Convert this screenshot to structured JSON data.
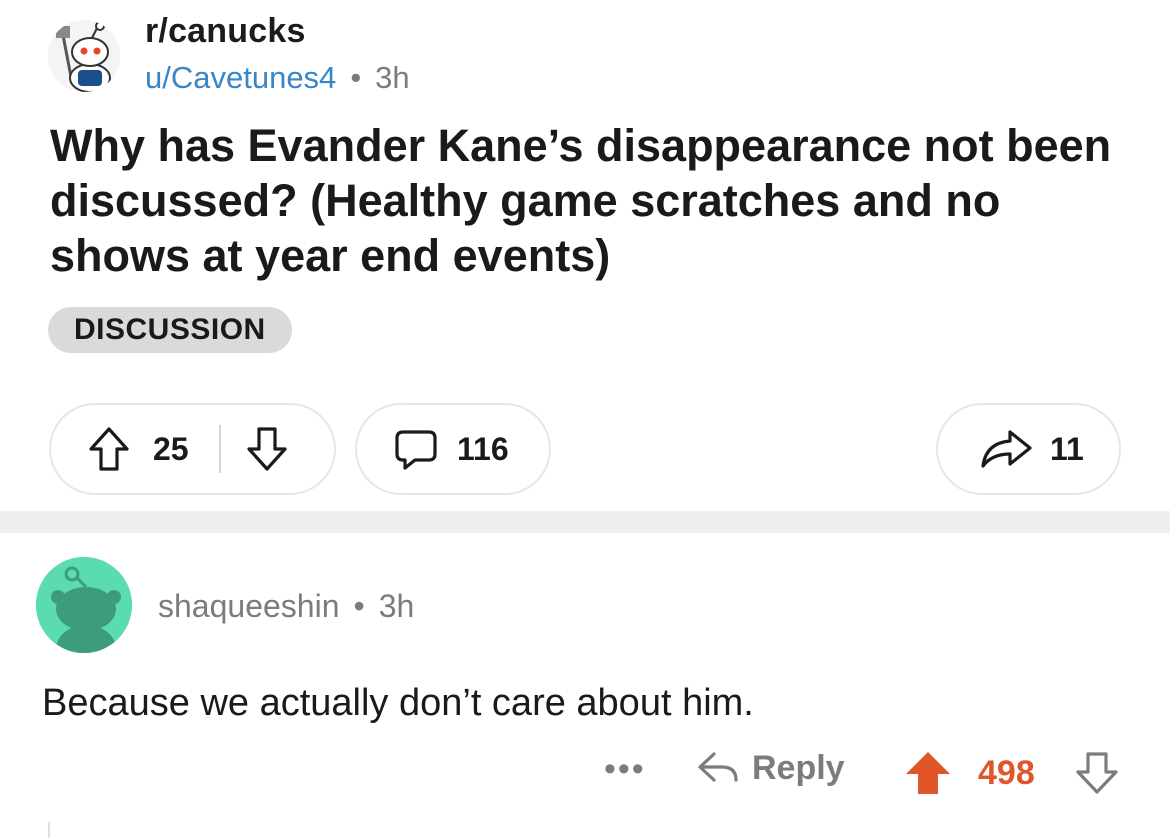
{
  "post": {
    "subreddit": "r/canucks",
    "author": "u/Cavetunes4",
    "separator": "•",
    "age": "3h",
    "title": "Why has Evander Kane’s disappearance not been discussed? (Healthy game scratches and no shows at year end events)",
    "flair": "DISCUSSION",
    "upvotes": "25",
    "comments": "116",
    "shares": "11"
  },
  "comment": {
    "author": "shaqueeshin",
    "separator": "•",
    "age": "3h",
    "body": "Because we actually don’t care about him.",
    "more": "•••",
    "reply_label": "Reply",
    "score": "498",
    "score_color": "#e0552a"
  },
  "icons": {
    "sub_avatar": "snoo-hockey-avatar",
    "upvote": "arrow-up-icon",
    "downvote": "arrow-down-icon",
    "comment": "speech-bubble-icon",
    "share": "share-arrow-icon",
    "reply": "reply-arrow-icon",
    "user_avatar": "snoo-avatar"
  },
  "colors": {
    "author_link": "#3a85c8",
    "upvoted": "#e0552a",
    "comment_avatar_bg": "#5bdbb0",
    "flair_bg": "#dadada"
  }
}
